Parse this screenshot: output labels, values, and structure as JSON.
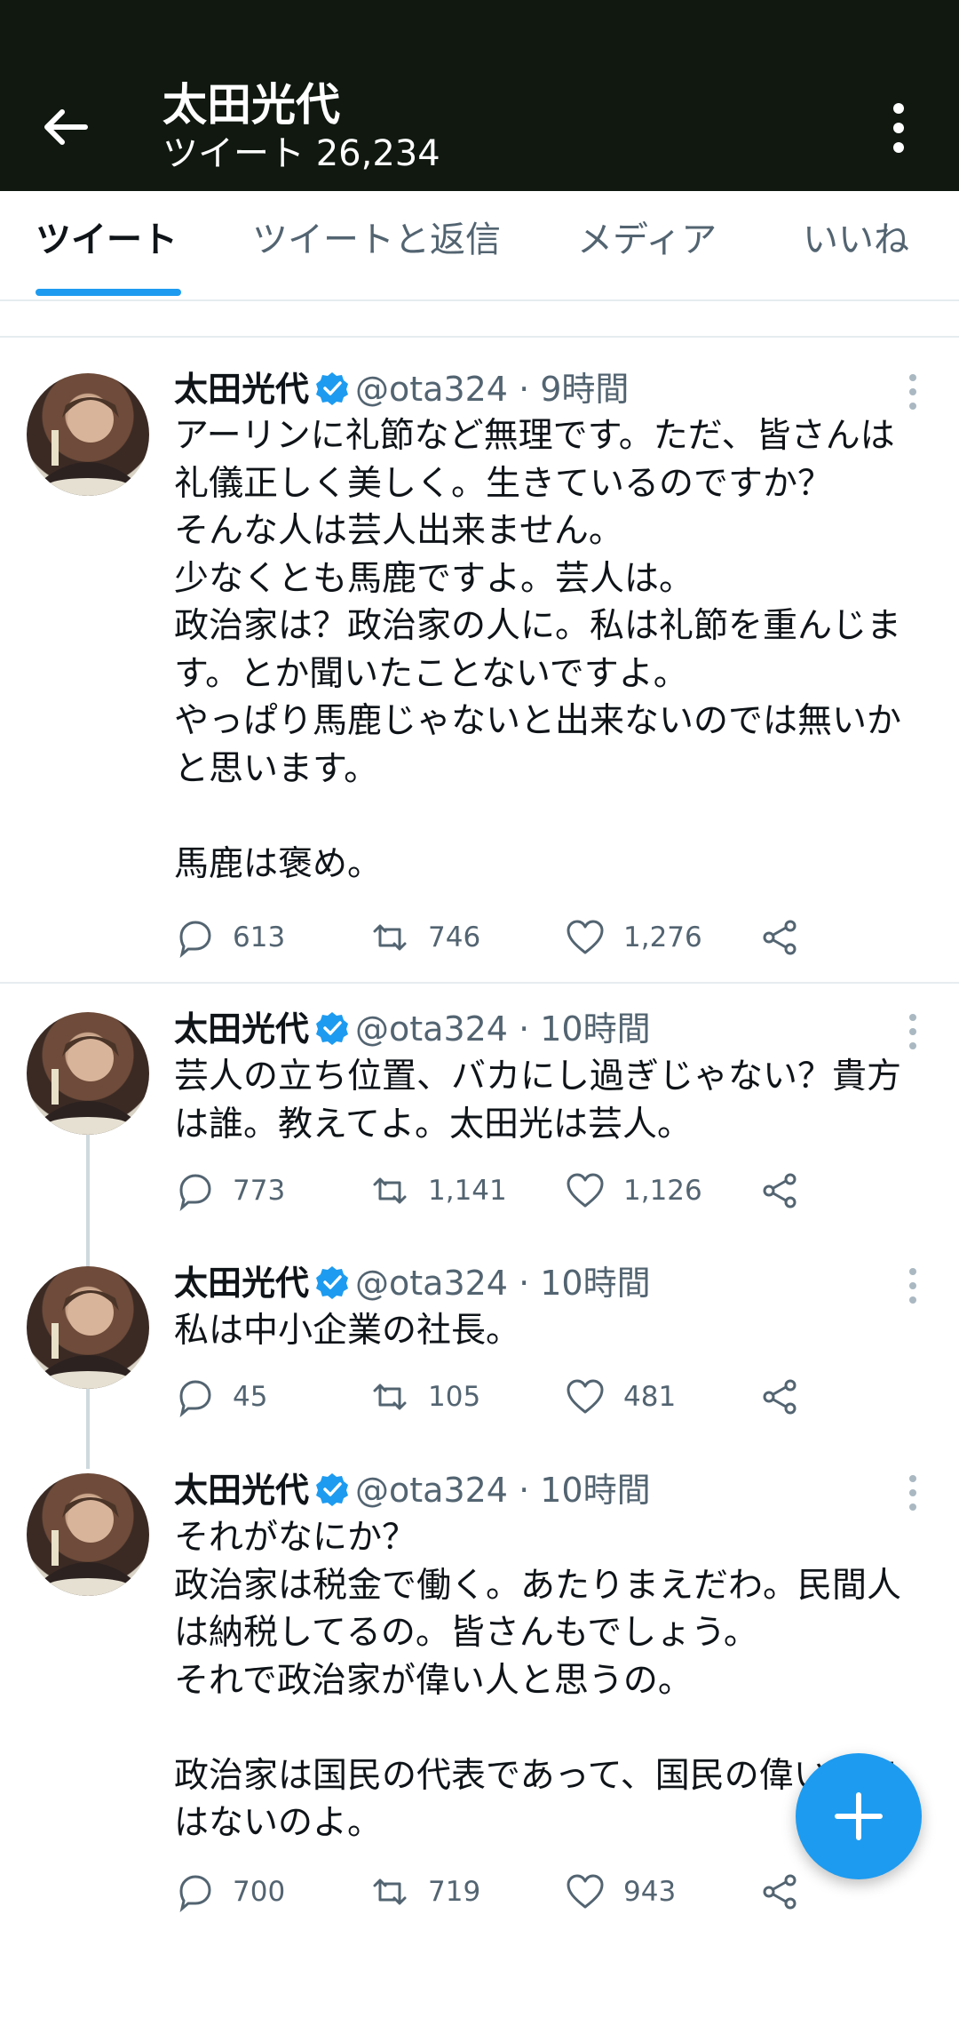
{
  "header": {
    "name": "太田光代",
    "tweet_count_label": "ツイート 26,234"
  },
  "tabs": [
    {
      "label": "ツイート",
      "active": true
    },
    {
      "label": "ツイートと返信",
      "active": false
    },
    {
      "label": "メディア",
      "active": false
    },
    {
      "label": "いいね",
      "active": false
    }
  ],
  "tweets": [
    {
      "name": "太田光代",
      "handle": "@ota324",
      "time": "· 9時間",
      "text": "アーリンに礼節など無理です。ただ、皆さんは礼儀正しく美しく。生きているのですか？\nそんな人は芸人出来ません。\n少なくとも馬鹿ですよ。芸人は。\n政治家は？政治家の人に。私は礼節を重んじます。とか聞いたことないですよ。\nやっぱり馬鹿じゃないと出来ないのでは無いかと思います。\n\n馬鹿は褒め。",
      "replies": "613",
      "retweets": "746",
      "likes": "1,276"
    },
    {
      "name": "太田光代",
      "handle": "@ota324",
      "time": "· 10時間",
      "text": "芸人の立ち位置、バカにし過ぎじゃない？貴方は誰。教えてよ。太田光は芸人。",
      "replies": "773",
      "retweets": "1,141",
      "likes": "1,126"
    },
    {
      "name": "太田光代",
      "handle": "@ota324",
      "time": "· 10時間",
      "text": "私は中小企業の社長。",
      "replies": "45",
      "retweets": "105",
      "likes": "481"
    },
    {
      "name": "太田光代",
      "handle": "@ota324",
      "time": "· 10時間",
      "text": "それがなにか？\n政治家は税金で働く。あたりまえだわ。民間人は納税してるの。皆さんもでしょう。\nそれで政治家が偉い人と思うの。\n\n政治家は国民の代表であって、国民の偉い人ではないのよ。",
      "replies": "700",
      "retweets": "719",
      "likes": "943"
    }
  ],
  "colors": {
    "header_bg": "#101810",
    "accent": "#1d9bf0",
    "secondary_text": "#536471"
  },
  "icons": {
    "back": "arrow-left-icon",
    "overflow": "more-vertical-icon",
    "verified": "verified-badge-icon",
    "reply": "comment-icon",
    "retweet": "retweet-icon",
    "like": "heart-icon",
    "share": "share-icon",
    "compose": "plus-icon"
  }
}
